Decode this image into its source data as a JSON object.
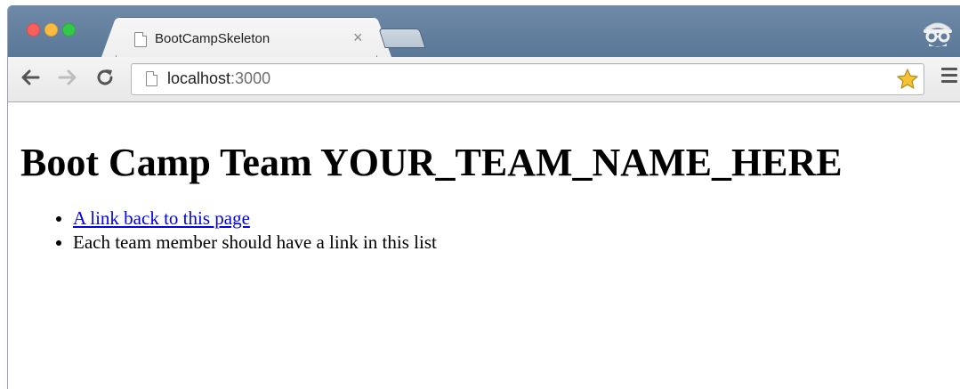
{
  "browser": {
    "tab_title": "BootCampSkeleton",
    "tab_close_glyph": "×",
    "url_host": "localhost",
    "url_port": ":3000",
    "icons": {
      "back": "back-arrow-icon",
      "forward": "forward-arrow-icon",
      "reload": "reload-icon",
      "page": "page-icon",
      "bookmark": "star-icon",
      "menu": "hamburger-menu-icon",
      "incognito": "incognito-icon"
    }
  },
  "page": {
    "heading": "Boot Camp Team YOUR_TEAM_NAME_HERE",
    "list": [
      {
        "text": "A link back to this page",
        "is_link": true
      },
      {
        "text": "Each team member should have a link in this list",
        "is_link": false
      }
    ]
  },
  "colors": {
    "tabstrip": "#5b7797",
    "link": "#0000ee",
    "star": "#f6c233"
  }
}
